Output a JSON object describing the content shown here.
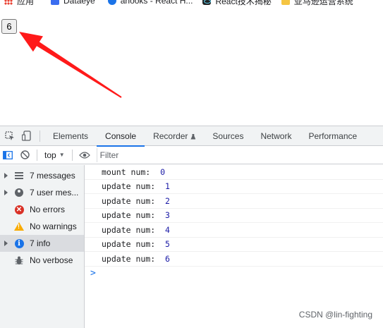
{
  "bookmarks": [
    {
      "label": "应用",
      "icon": "apps-grid-icon"
    },
    {
      "label": "Dataeye",
      "icon": "dataeye-icon"
    },
    {
      "label": "ahooks - React H...",
      "icon": "ahooks-icon"
    },
    {
      "label": "React技术揭秘",
      "icon": "react-icon"
    },
    {
      "label": "亚马逊运营系统",
      "icon": "amazon-icon"
    }
  ],
  "page": {
    "counter_button_label": "6"
  },
  "devtools": {
    "tabs": [
      "Elements",
      "Console",
      "Recorder",
      "Sources",
      "Network",
      "Performance"
    ],
    "active_tab": "Console",
    "toolbar": {
      "context": "top",
      "filter_placeholder": "Filter"
    },
    "sidebar": [
      {
        "label": "7 messages",
        "icon": "list-icon",
        "expandable": true
      },
      {
        "label": "7 user mes...",
        "icon": "user-icon",
        "expandable": true
      },
      {
        "label": "No errors",
        "icon": "error-icon",
        "expandable": false
      },
      {
        "label": "No warnings",
        "icon": "warning-icon",
        "expandable": false
      },
      {
        "label": "7 info",
        "icon": "info-icon",
        "expandable": true,
        "selected": true
      },
      {
        "label": "No verbose",
        "icon": "verbose-bug-icon",
        "expandable": false
      }
    ],
    "console_logs": [
      {
        "text": "mount num:  ",
        "value": "0"
      },
      {
        "text": "update num:  ",
        "value": "1"
      },
      {
        "text": "update num:  ",
        "value": "2"
      },
      {
        "text": "update num:  ",
        "value": "3"
      },
      {
        "text": "update num:  ",
        "value": "4"
      },
      {
        "text": "update num:  ",
        "value": "5"
      },
      {
        "text": "update num:  ",
        "value": "6"
      }
    ],
    "prompt_symbol": ">"
  },
  "annotations": {
    "arrow_color": "#ff1a1a"
  },
  "watermark": "CSDN @lin-fighting"
}
